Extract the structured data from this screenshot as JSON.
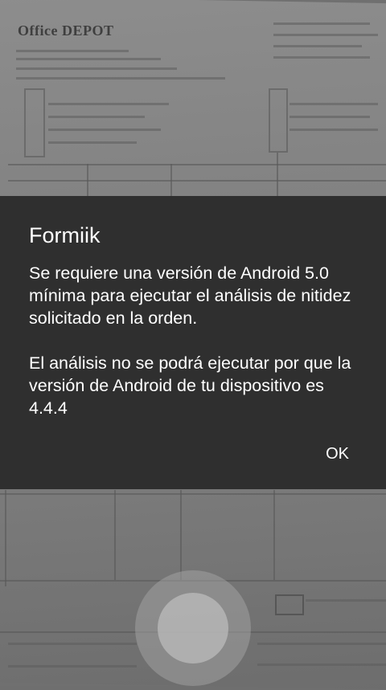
{
  "document_background": {
    "logo_text": "Office DEPOT"
  },
  "dialog": {
    "title": "Formiik",
    "message_1": "Se requiere una versión de Android 5.0 mínima para ejecutar el análisis de nitidez solicitado en la orden.",
    "message_2": "El análisis no se podrá ejecutar por que la versión de Android de tu dispositivo es 4.4.4",
    "ok_label": "OK"
  },
  "colors": {
    "dialog_bg": "#2f2f2f",
    "text": "#ffffff"
  }
}
